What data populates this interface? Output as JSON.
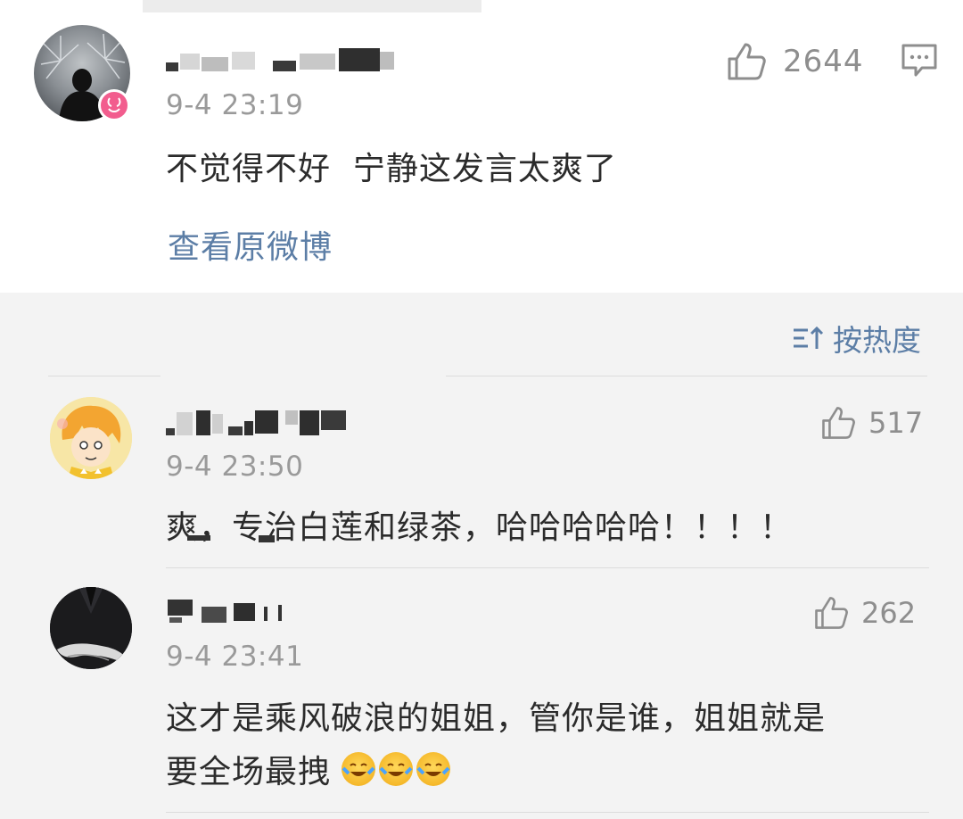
{
  "top_comment": {
    "time": "9-4 23:19",
    "likes": "2644",
    "text": "不觉得不好  宁静这发言太爽了",
    "link": "查看原微博"
  },
  "sort": {
    "label": "按热度",
    "icon": "sort-icon"
  },
  "comments": [
    {
      "time": "9-4 23:50",
      "likes": "517",
      "text": "爽，专治白莲和绿茶，哈哈哈哈哈！！！！"
    },
    {
      "time": "9-4 23:41",
      "likes": "262",
      "text_line1": "这才是乘风破浪的姐姐，管你是谁，姐姐就是",
      "text_line2": "要全场最拽"
    }
  ],
  "colors": {
    "link": "#5c7ea6",
    "muted": "#9a9a9a",
    "badge": "#f25d8e"
  }
}
